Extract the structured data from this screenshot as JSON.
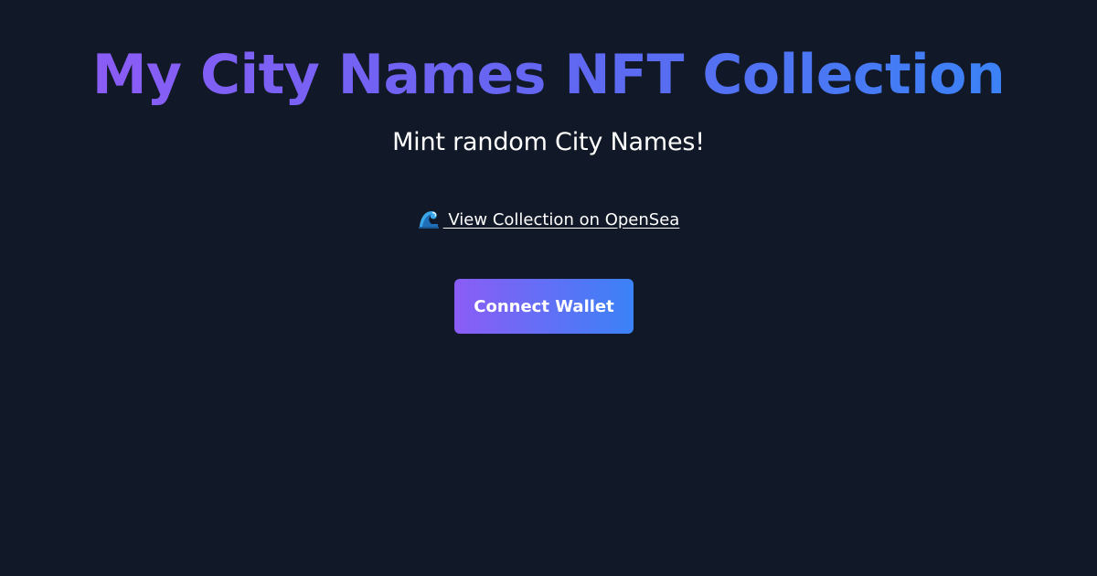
{
  "header": {
    "title": "My City Names NFT Collection",
    "subtitle": "Mint random City Names!"
  },
  "links": {
    "opensea_icon": "water-wave-icon",
    "opensea_label": " View Collection on OpenSea"
  },
  "actions": {
    "connect_wallet_label": "Connect Wallet"
  },
  "colors": {
    "background": "#111827",
    "gradient_start": "#8b5cf6",
    "gradient_end": "#3b82f6",
    "text": "#ffffff"
  }
}
